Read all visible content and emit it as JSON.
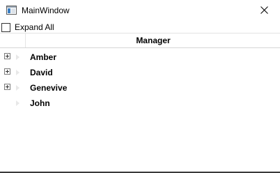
{
  "window": {
    "title": "MainWindow"
  },
  "options": {
    "expand_all_label": "Expand All",
    "expand_all_checked": false
  },
  "grid": {
    "columns": [
      "Manager"
    ],
    "rows": [
      {
        "name": "Amber",
        "has_children": true
      },
      {
        "name": "David",
        "has_children": true
      },
      {
        "name": "Genevive",
        "has_children": true
      },
      {
        "name": "John",
        "has_children": false
      }
    ]
  }
}
